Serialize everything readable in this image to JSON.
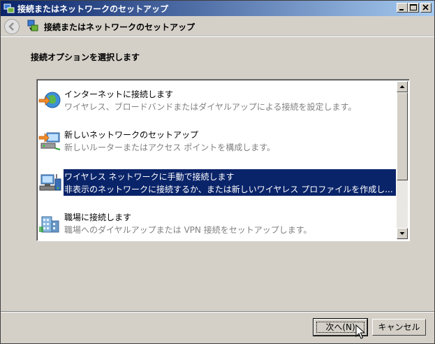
{
  "window": {
    "title": "接続またはネットワークのセットアップ",
    "accent": "#0a246a"
  },
  "nav": {
    "title": "接続またはネットワークのセットアップ"
  },
  "content": {
    "heading": "接続オプションを選択します",
    "options": [
      {
        "title": "インターネットに接続します",
        "description": "ワイヤレス、ブロードバンドまたはダイヤルアップによる接続を設定します。",
        "icon": "globe-connect-icon"
      },
      {
        "title": "新しいネットワークのセットアップ",
        "description": "新しいルーターまたはアクセス ポイントを構成します。",
        "icon": "network-setup-icon"
      },
      {
        "title": "ワイヤレス ネットワークに手動で接続します",
        "description": "非表示のネットワークに接続するか、または新しいワイヤレス プロファイルを作成し...",
        "icon": "wireless-network-icon",
        "selected": true
      },
      {
        "title": "職場に接続します",
        "description": "職場へのダイヤルアップまたは VPN 接続をセットアップします。",
        "icon": "workplace-icon"
      }
    ]
  },
  "buttons": {
    "next": "次へ(N)",
    "cancel": "キャンセル"
  }
}
